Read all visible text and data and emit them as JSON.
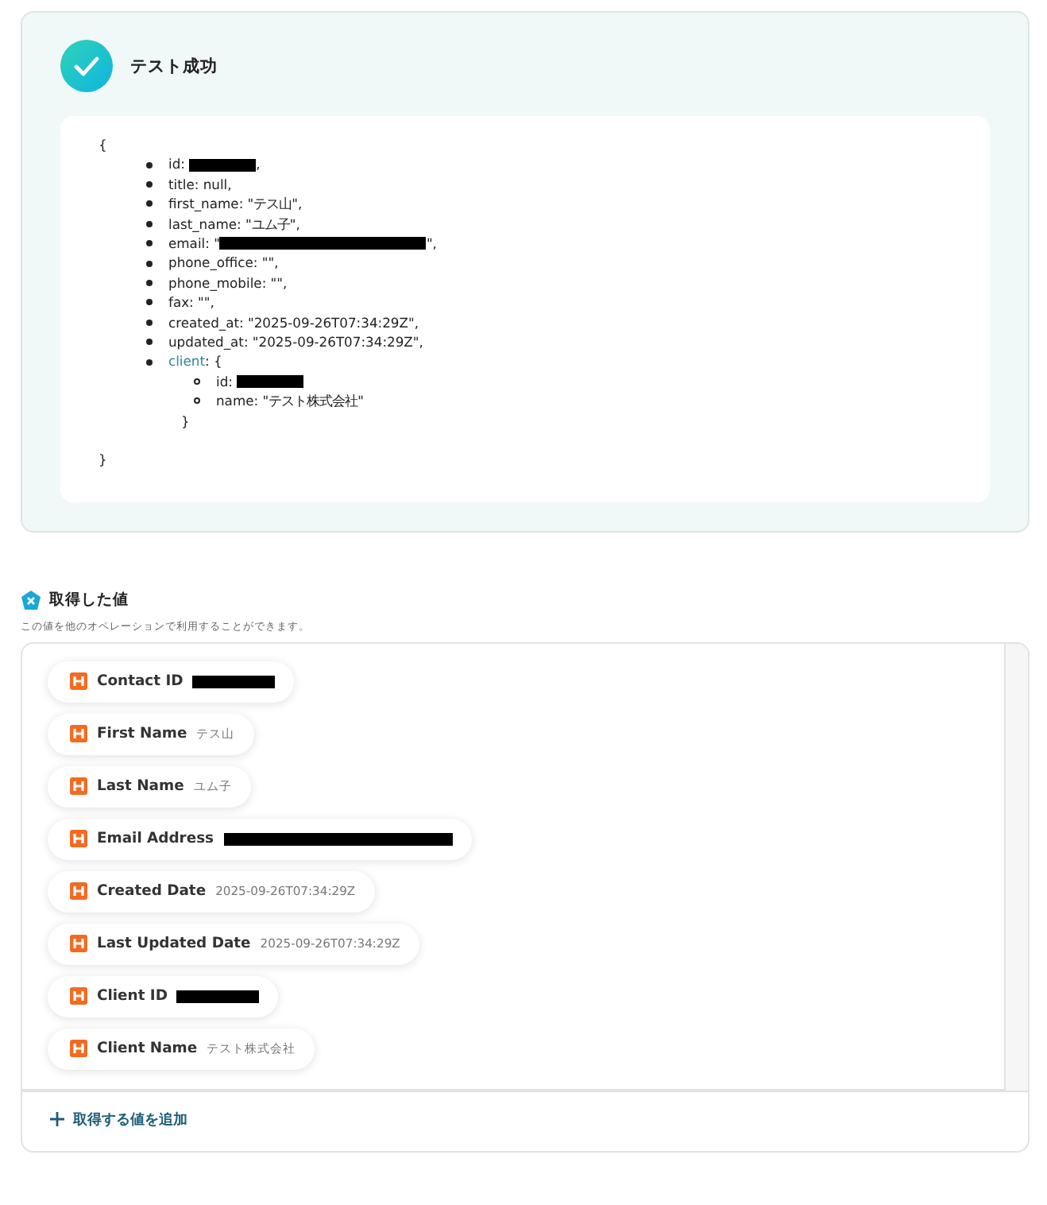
{
  "result": {
    "title": "テスト成功",
    "json": {
      "open": "{",
      "close": "}",
      "lines": [
        {
          "key": "id",
          "text": ": ",
          "redacted": true,
          "after": ","
        },
        {
          "key": "title",
          "text": ": null,"
        },
        {
          "key": "first_name",
          "text": ": \"テス山\","
        },
        {
          "key": "last_name",
          "text": ": \"ユム子\","
        },
        {
          "key": "email",
          "text": ": \"",
          "redacted": true,
          "kind": "long",
          "after": "\","
        },
        {
          "key": "phone_office",
          "text": ": \"\","
        },
        {
          "key": "phone_mobile",
          "text": ": \"\","
        },
        {
          "key": "fax",
          "text": ": \"\","
        },
        {
          "key": "created_at",
          "text": ": \"2025-09-26T07:34:29Z\","
        },
        {
          "key": "updated_at",
          "text": ": \"2025-09-26T07:34:29Z\","
        },
        {
          "key": "client",
          "kind": "object",
          "text": ": {",
          "close": "}",
          "children": [
            {
              "key": "id",
              "text": ": ",
              "redacted": true
            },
            {
              "key": "name",
              "text": ": \"テスト株式会社\""
            }
          ]
        }
      ]
    }
  },
  "values": {
    "title": "取得した値",
    "subtitle": "この値を他のオペレーションで利用することができます。",
    "items": [
      {
        "label": "Contact ID",
        "redacted": true
      },
      {
        "label": "First Name",
        "value": "テス山"
      },
      {
        "label": "Last Name",
        "value": "ユム子"
      },
      {
        "label": "Email Address",
        "redacted": true,
        "kind": "long"
      },
      {
        "label": "Created Date",
        "value": "2025-09-26T07:34:29Z"
      },
      {
        "label": "Last Updated Date",
        "value": "2025-09-26T07:34:29Z"
      },
      {
        "label": "Client ID",
        "redacted": true
      },
      {
        "label": "Client Name",
        "value": "テスト株式会社"
      }
    ],
    "add_button": "取得する値を追加"
  }
}
